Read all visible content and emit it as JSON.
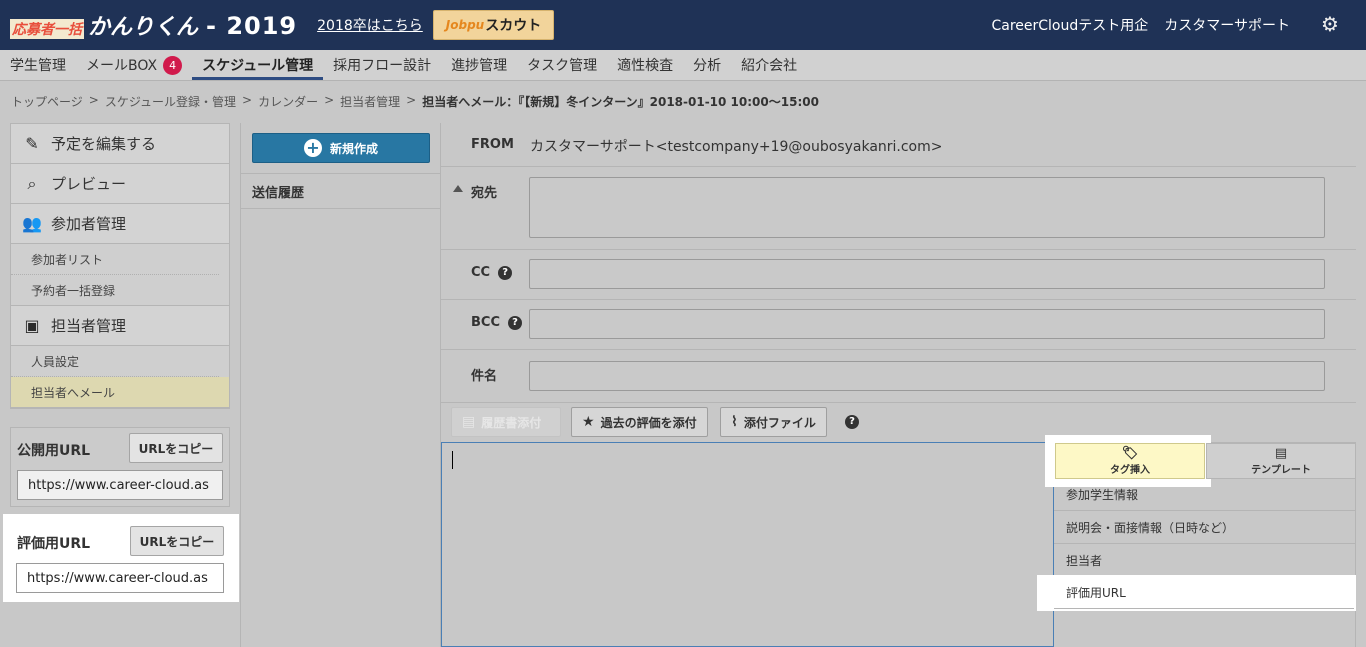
{
  "header": {
    "logo_small": "応募者一括",
    "logo_main": "かんりくん",
    "logo_year": "- 2019",
    "prev_link": "2018卒はこちら",
    "scout_logo": "Jobpu",
    "scout_label": "スカウト",
    "company": "CareerCloudテスト用企",
    "user": "カスタマーサポート",
    "gear_icon": "⚙"
  },
  "nav": {
    "items": [
      {
        "label": "学生管理"
      },
      {
        "label": "メールBOX",
        "badge": "4"
      },
      {
        "label": "スケジュール管理"
      },
      {
        "label": "採用フロー設計"
      },
      {
        "label": "進捗管理"
      },
      {
        "label": "タスク管理"
      },
      {
        "label": "適性検査"
      },
      {
        "label": "分析"
      },
      {
        "label": "紹介会社"
      }
    ]
  },
  "breadcrumb": {
    "items": [
      "トップページ",
      ">",
      "スケジュール登録・管理",
      ">",
      "カレンダー",
      ">",
      "担当者管理",
      ">"
    ],
    "current": "担当者へメール：『【新規】冬インターン』2018-01-10 10:00〜15:00"
  },
  "sidebar": {
    "edit": "予定を編集する",
    "preview": "プレビュー",
    "participants": "参加者管理",
    "participant_list": "参加者リスト",
    "bulk_register": "予約者一括登録",
    "staff": "担当者管理",
    "staff_settings": "人員設定",
    "staff_mail": "担当者へメール"
  },
  "public_url": {
    "label": "公開用URL",
    "copy": "URLをコピー",
    "value": "https://www.career-cloud.as"
  },
  "eval_url": {
    "label": "評価用URL",
    "copy": "URLをコピー",
    "value": "https://www.career-cloud.as"
  },
  "mid": {
    "new_button": "新規作成",
    "history": "送信履歴"
  },
  "compose": {
    "from_label": "FROM",
    "from_value": "カスタマーサポート<testcompany+19@oubosyakanri.com>",
    "to_label": "宛先",
    "cc_label": "CC",
    "bcc_label": "BCC",
    "subject_label": "件名",
    "btn_resume": "履歴書添付",
    "btn_eval": "過去の評価を添付",
    "btn_file": "添付ファイル"
  },
  "tagpanel": {
    "tab_tag": "タグ挿入",
    "tab_template": "テンプレート",
    "items": [
      "参加学生情報",
      "説明会・面接情報（日時など）",
      "担当者"
    ],
    "highlight_item": "評価用URL"
  }
}
